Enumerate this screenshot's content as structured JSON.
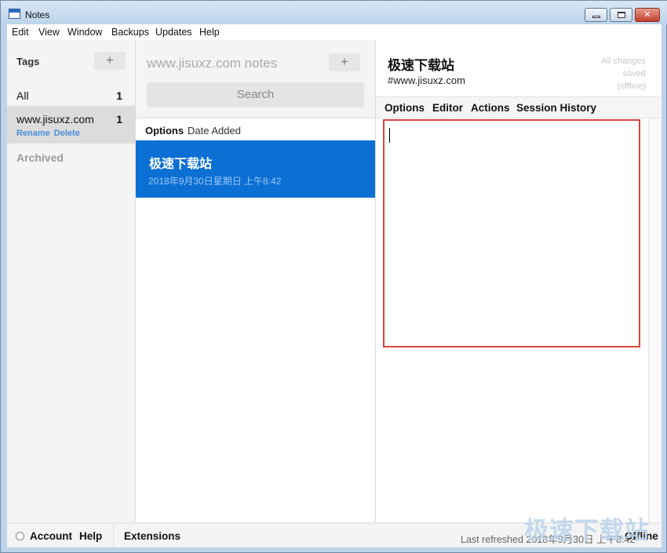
{
  "window": {
    "title": "Notes"
  },
  "menu": [
    "Edit",
    "View",
    "Window",
    "Backups",
    "Updates",
    "Help"
  ],
  "tags": {
    "title": "Tags",
    "add_label": "+",
    "items": [
      {
        "label": "All",
        "count": "1"
      },
      {
        "label": "www.jisuxz.com",
        "count": "1",
        "rename": "Rename",
        "delete": "Delete"
      }
    ],
    "archived": "Archived"
  },
  "notes": {
    "title": "www.jisuxz.com notes",
    "add_label": "+",
    "search_placeholder": "Search",
    "sort_options": "Options",
    "sort_label": "Date Added",
    "items": [
      {
        "title": "极速下载站",
        "date": "2018年9月30日星期日 上午8:42"
      }
    ]
  },
  "editor": {
    "title": "极速下载站",
    "tag": "#www.jisuxz.com",
    "save_status": [
      "All changes",
      "saved",
      "(offline)"
    ],
    "toolbar": [
      "Options",
      "Editor",
      "Actions",
      "Session History"
    ]
  },
  "footer": {
    "account": "Account",
    "help": "Help",
    "extensions": "Extensions",
    "status": "Last refreshed 2018年9月30日 上午8:42",
    "offline": "Offline"
  },
  "watermark": "极速下载站",
  "colors": {
    "selection": "#0c6fd4",
    "highlight_border": "#d9453e",
    "link": "#4a90d9"
  }
}
